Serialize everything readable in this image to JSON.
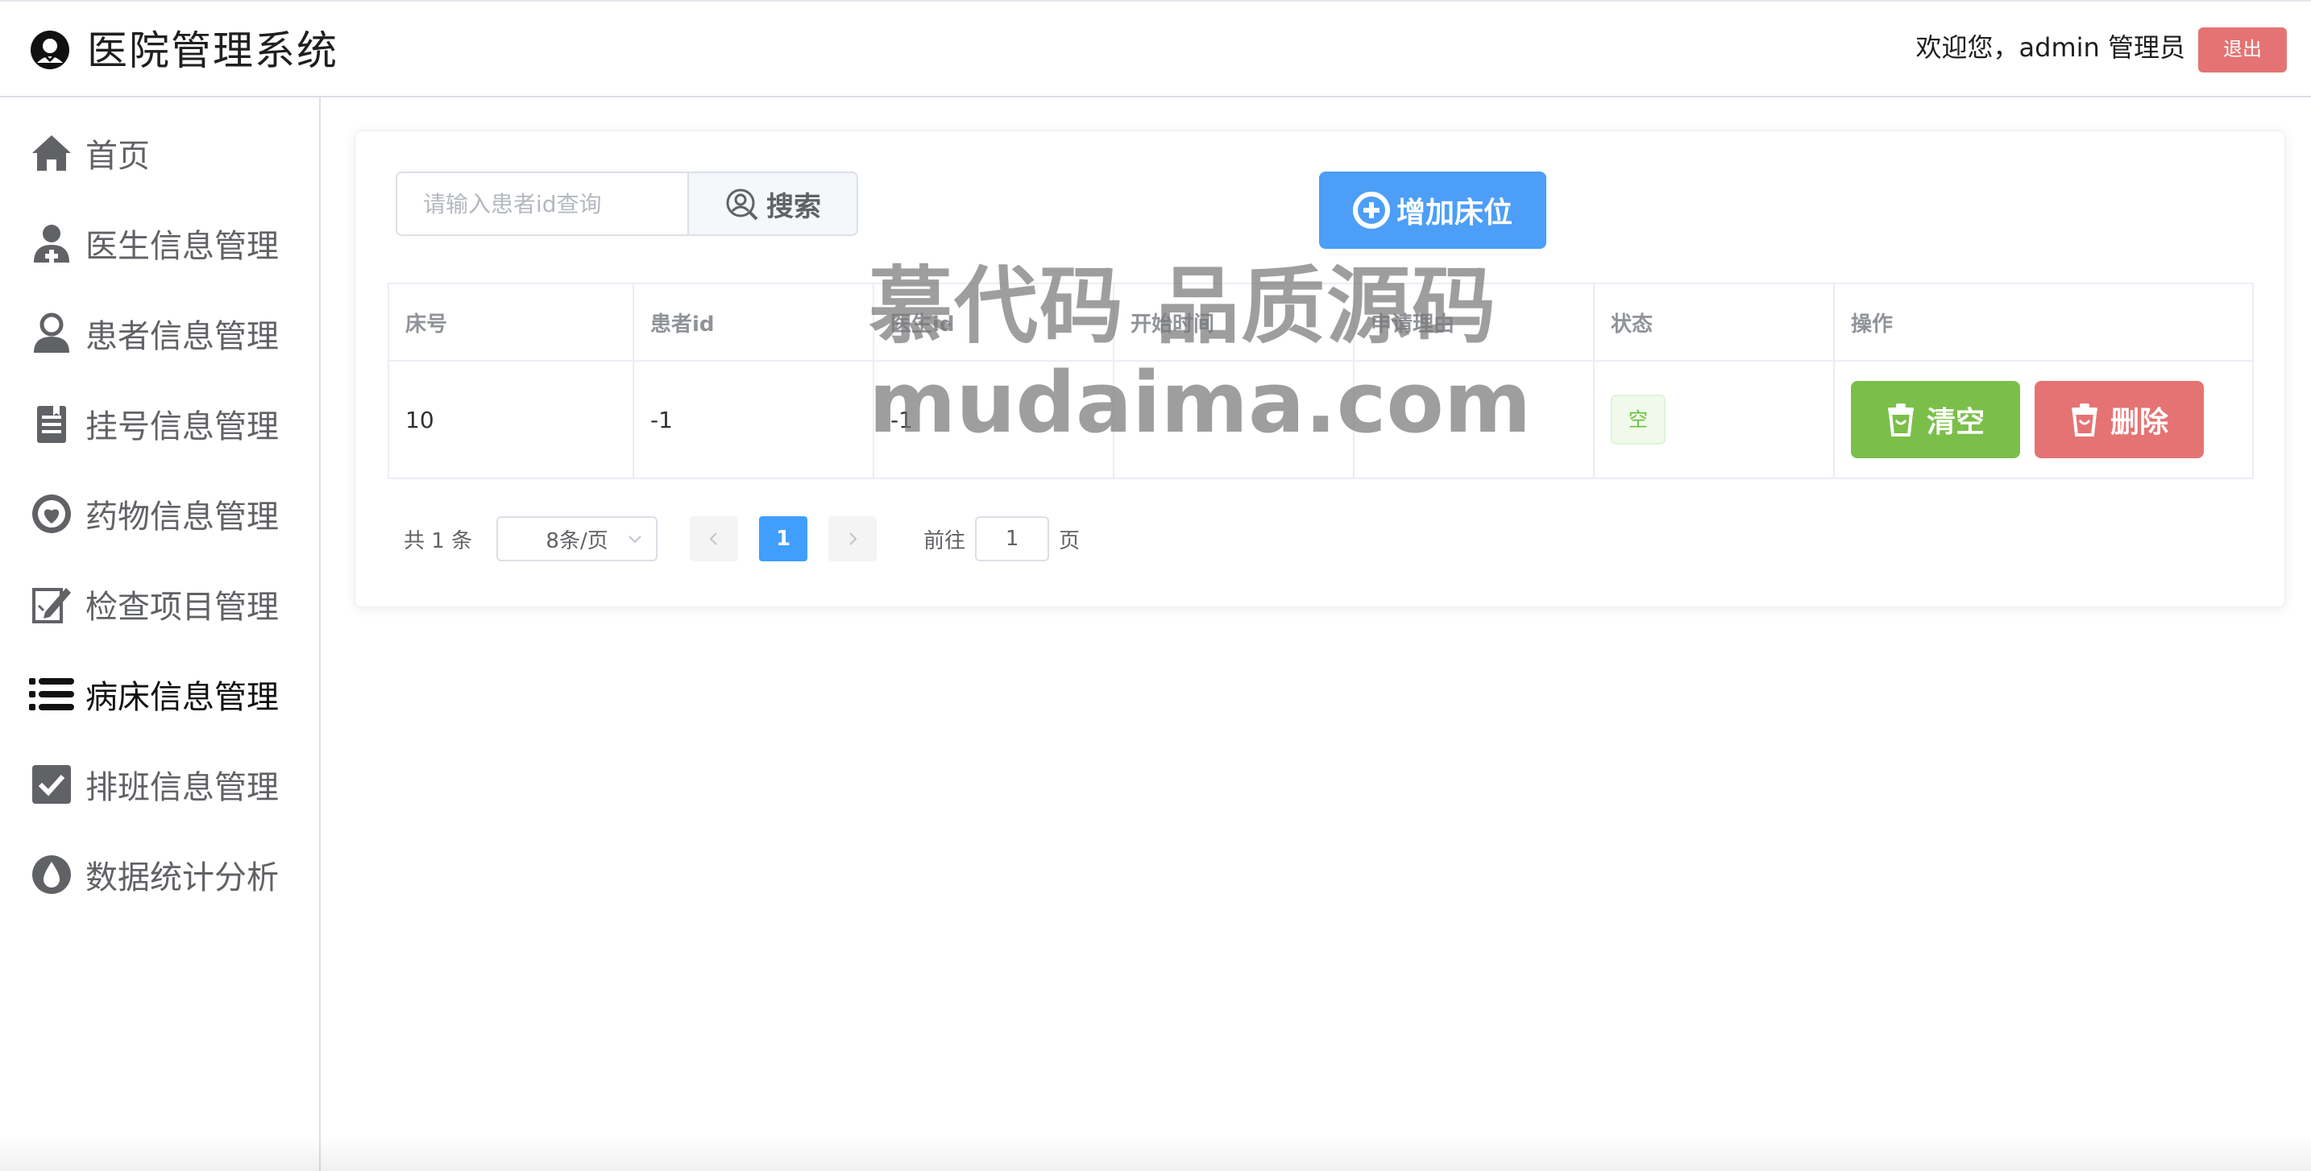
{
  "header": {
    "app_title": "医院管理系统",
    "welcome_text": "欢迎您，admin 管理员",
    "logout_label": "退出"
  },
  "sidebar": {
    "items": [
      {
        "label": "首页",
        "icon": "home-icon"
      },
      {
        "label": "医生信息管理",
        "icon": "doctor-icon"
      },
      {
        "label": "患者信息管理",
        "icon": "patient-icon"
      },
      {
        "label": "挂号信息管理",
        "icon": "clipboard-icon"
      },
      {
        "label": "药物信息管理",
        "icon": "medicine-icon"
      },
      {
        "label": "检查项目管理",
        "icon": "edit-icon"
      },
      {
        "label": "病床信息管理",
        "icon": "list-icon"
      },
      {
        "label": "排班信息管理",
        "icon": "checkbox-icon"
      },
      {
        "label": "数据统计分析",
        "icon": "drop-icon"
      }
    ],
    "active": "病床信息管理"
  },
  "toolbar": {
    "search_placeholder": "请输入患者id查询",
    "search_label": "搜索",
    "add_label": "增加床位"
  },
  "table": {
    "columns": [
      "床号",
      "患者id",
      "医生id",
      "开始时间",
      "申请理由",
      "状态",
      "操作"
    ],
    "rows": [
      {
        "bed_no": "10",
        "patient_id": "-1",
        "doctor_id": "-1",
        "start_time": "",
        "reason": "",
        "status": "空"
      }
    ],
    "actions": {
      "clear_label": "清空",
      "delete_label": "删除"
    }
  },
  "pagination": {
    "total_text": "共 1 条",
    "page_size": "8条/页",
    "current_page": "1",
    "goto_prefix": "前往",
    "goto_value": "1",
    "goto_suffix": "页"
  },
  "watermark": {
    "line1": "慕代码 品质源码",
    "line2": "mudaima.com"
  },
  "colors": {
    "primary": "#409eff",
    "add_button": "#4c9ef7",
    "success": "#7bbf4a",
    "danger": "#e57373",
    "tag_success_text": "#67c23a"
  }
}
